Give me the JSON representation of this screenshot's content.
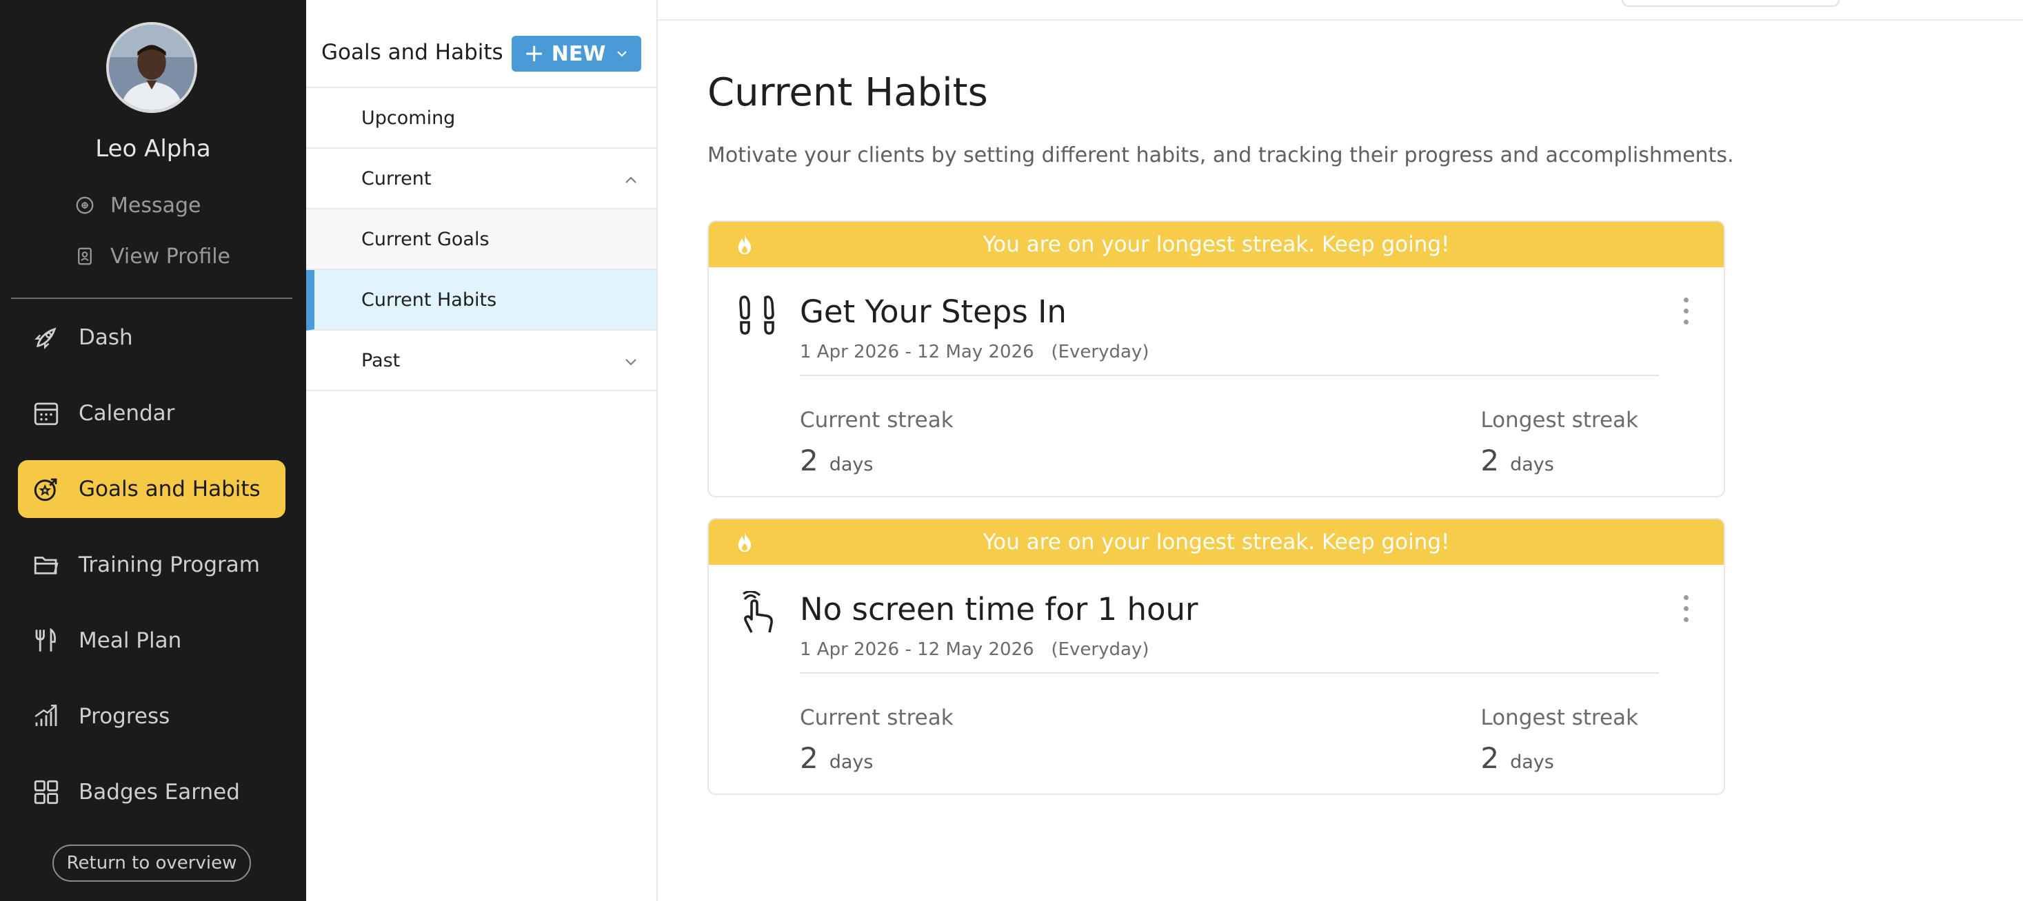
{
  "sidebar": {
    "client_name": "Leo Alpha",
    "links": [
      {
        "label": "Message",
        "icon": "chat-icon"
      },
      {
        "label": "View Profile",
        "icon": "profile-card-icon"
      }
    ],
    "nav": [
      {
        "label": "Dash",
        "icon": "rocket-icon",
        "active": false
      },
      {
        "label": "Calendar",
        "icon": "calendar-icon",
        "active": false
      },
      {
        "label": "Goals and Habits",
        "icon": "target-star-icon",
        "active": true
      },
      {
        "label": "Training Program",
        "icon": "folder-icon",
        "active": false
      },
      {
        "label": "Meal Plan",
        "icon": "fork-knife-icon",
        "active": false
      },
      {
        "label": "Progress",
        "icon": "growth-chart-icon",
        "active": false
      },
      {
        "label": "Badges Earned",
        "icon": "grid-icon",
        "active": false
      }
    ],
    "return_label": "Return to overview"
  },
  "subpanel": {
    "title": "Goals and Habits",
    "new_label": "NEW",
    "items": [
      {
        "label": "Upcoming"
      },
      {
        "label": "Current",
        "expanded": true
      },
      {
        "label": "Current Goals"
      },
      {
        "label": "Current Habits",
        "selected": true
      },
      {
        "label": "Past",
        "expanded": false
      }
    ]
  },
  "main": {
    "title": "Current Habits",
    "description": "Motivate your clients by setting different habits, and tracking their progress and accomplishments."
  },
  "habits": [
    {
      "banner": "You are on your longest streak. Keep going!",
      "icon": "footprints-icon",
      "title": "Get Your Steps In",
      "dates": "1 Apr 2026 - 12 May 2026",
      "frequency": "(Everyday)",
      "current_label": "Current streak",
      "current_value": "2",
      "current_unit": "days",
      "longest_label": "Longest streak",
      "longest_value": "2",
      "longest_unit": "days"
    },
    {
      "banner": "You are on your longest streak. Keep going!",
      "icon": "finger-tap-icon",
      "title": "No screen time for 1 hour",
      "dates": "1 Apr 2026 - 12 May 2026",
      "frequency": "(Everyday)",
      "current_label": "Current streak",
      "current_value": "2",
      "current_unit": "days",
      "longest_label": "Longest streak",
      "longest_value": "2",
      "longest_unit": "days"
    }
  ],
  "colors": {
    "sidebar_bg": "#1b1b1b",
    "accent_yellow": "#f5c946",
    "new_button_blue": "#4b9ad8",
    "selected_row_bg": "#e1f3fc"
  }
}
